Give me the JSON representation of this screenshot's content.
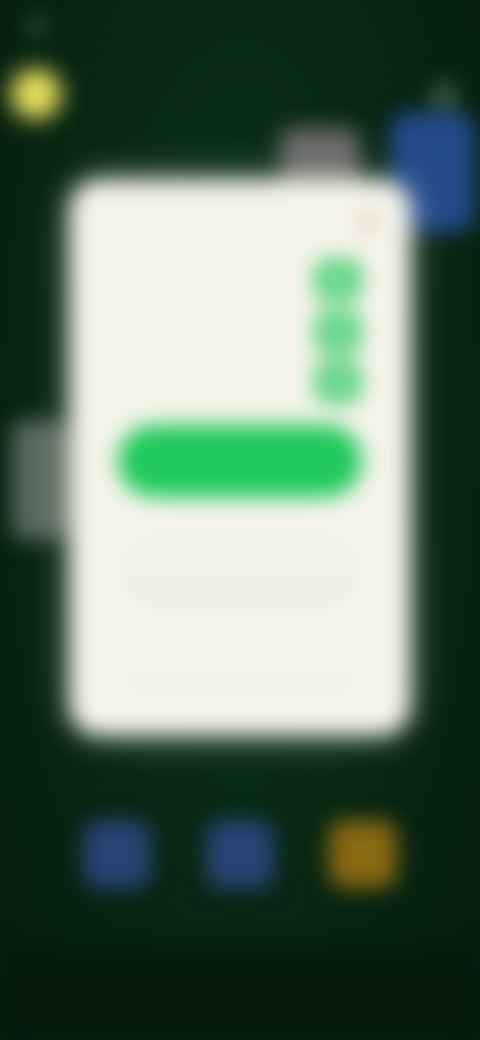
{
  "status_bar": {
    "time": "",
    "indicator": "status-dot"
  },
  "hud": {
    "coin_count": "",
    "title": "",
    "icons": {
      "coin": "coin-icon",
      "settings": "gear-icon"
    }
  },
  "settings_modal": {
    "title": "",
    "close_label": "✕",
    "options": [
      {
        "label": "",
        "enabled": true
      },
      {
        "label": "",
        "enabled": true
      },
      {
        "label": "",
        "enabled": true
      }
    ],
    "primary_button_label": "",
    "secondary_button_label": "",
    "link_label": ""
  },
  "bottom_bar": {
    "tools": [
      {
        "icon": "tool-icon",
        "color": "#2a4476"
      },
      {
        "icon": "tool-icon",
        "color": "#2a4476"
      },
      {
        "icon": "tool-icon",
        "color": "#8a6a12"
      }
    ]
  },
  "colors": {
    "background": "#082612",
    "modal": "#f4f4e9",
    "accent_green": "#1fc95c",
    "close_red": "#e94f4f",
    "coin_yellow": "#e6df5a"
  }
}
